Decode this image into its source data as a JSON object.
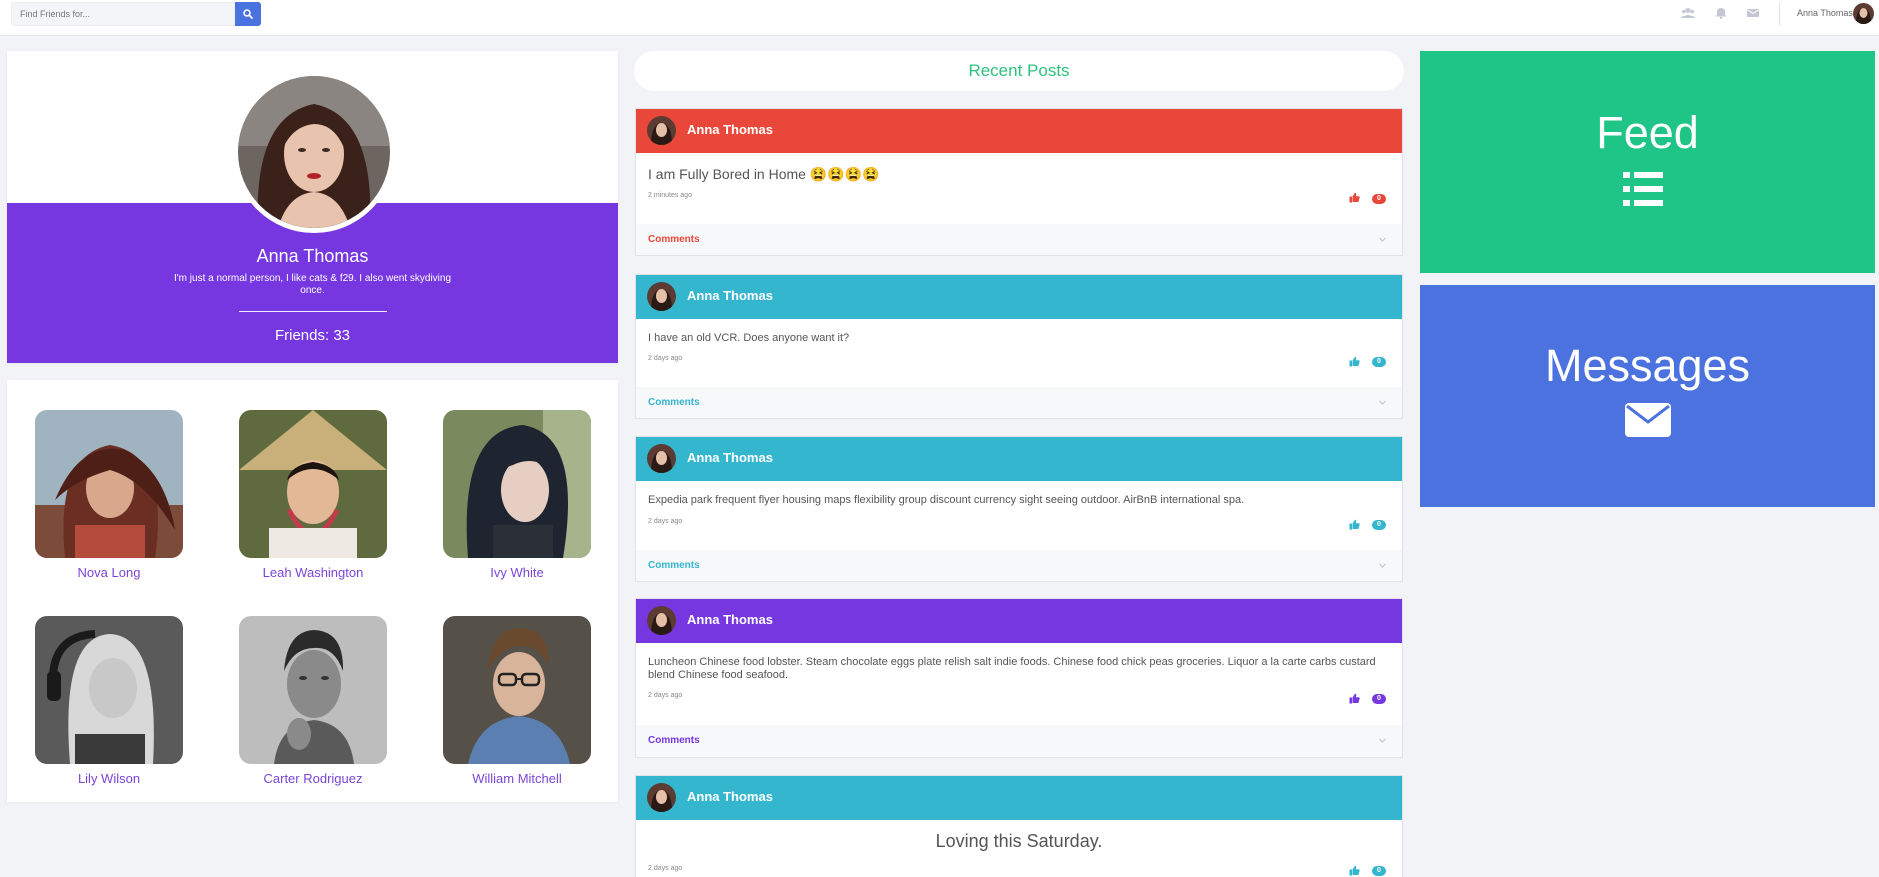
{
  "topbar": {
    "search_placeholder": "Find Friends for...",
    "user_name": "Anna Thomas",
    "icons": [
      "search-icon",
      "users-icon",
      "bell-icon",
      "envelope-icon"
    ]
  },
  "profile": {
    "name": "Anna Thomas",
    "bio": "I'm just a normal person, I like cats & f29. I also went skydiving once.",
    "friends_label": "Friends: 33"
  },
  "friends": [
    {
      "name": "Nova Long"
    },
    {
      "name": "Leah Washington"
    },
    {
      "name": "Ivy White"
    },
    {
      "name": "Lily Wilson"
    },
    {
      "name": "Carter Rodriguez"
    },
    {
      "name": "William Mitchell"
    }
  ],
  "recent_posts": {
    "title": "Recent Posts",
    "posts": [
      {
        "author": "Anna Thomas",
        "text": "I am Fully Bored in Home 😫😫😫😫",
        "time": "2 minutes ago",
        "likes": "0",
        "comments_label": "Comments",
        "color": "#e8473a"
      },
      {
        "author": "Anna Thomas",
        "text": "I have an old VCR. Does anyone want it?",
        "time": "2 days ago",
        "likes": "0",
        "comments_label": "Comments",
        "color": "#35b6cf"
      },
      {
        "author": "Anna Thomas",
        "text": "Expedia park frequent flyer housing maps flexibility group discount currency sight seeing outdoor. AirBnB international spa.",
        "time": "2 days ago",
        "likes": "0",
        "comments_label": "Comments",
        "color": "#35b6cf"
      },
      {
        "author": "Anna Thomas",
        "text": "Luncheon Chinese food lobster. Steam chocolate eggs plate relish salt indie foods. Chinese food chick peas groceries. Liquor a la carte carbs custard blend Chinese food seafood.",
        "time": "2 days ago",
        "likes": "0",
        "comments_label": "Comments",
        "color": "#7637e1"
      },
      {
        "author": "Anna Thomas",
        "text": "Loving this Saturday.",
        "time": "2 days ago",
        "likes": "0",
        "comments_label": "Comments",
        "color": "#35b6cf"
      }
    ]
  },
  "tiles": {
    "feed": {
      "title": "Feed",
      "icon": "list-icon",
      "color": "#1fc586"
    },
    "messages": {
      "title": "Messages",
      "icon": "envelope-icon",
      "color": "#4b72de"
    }
  }
}
